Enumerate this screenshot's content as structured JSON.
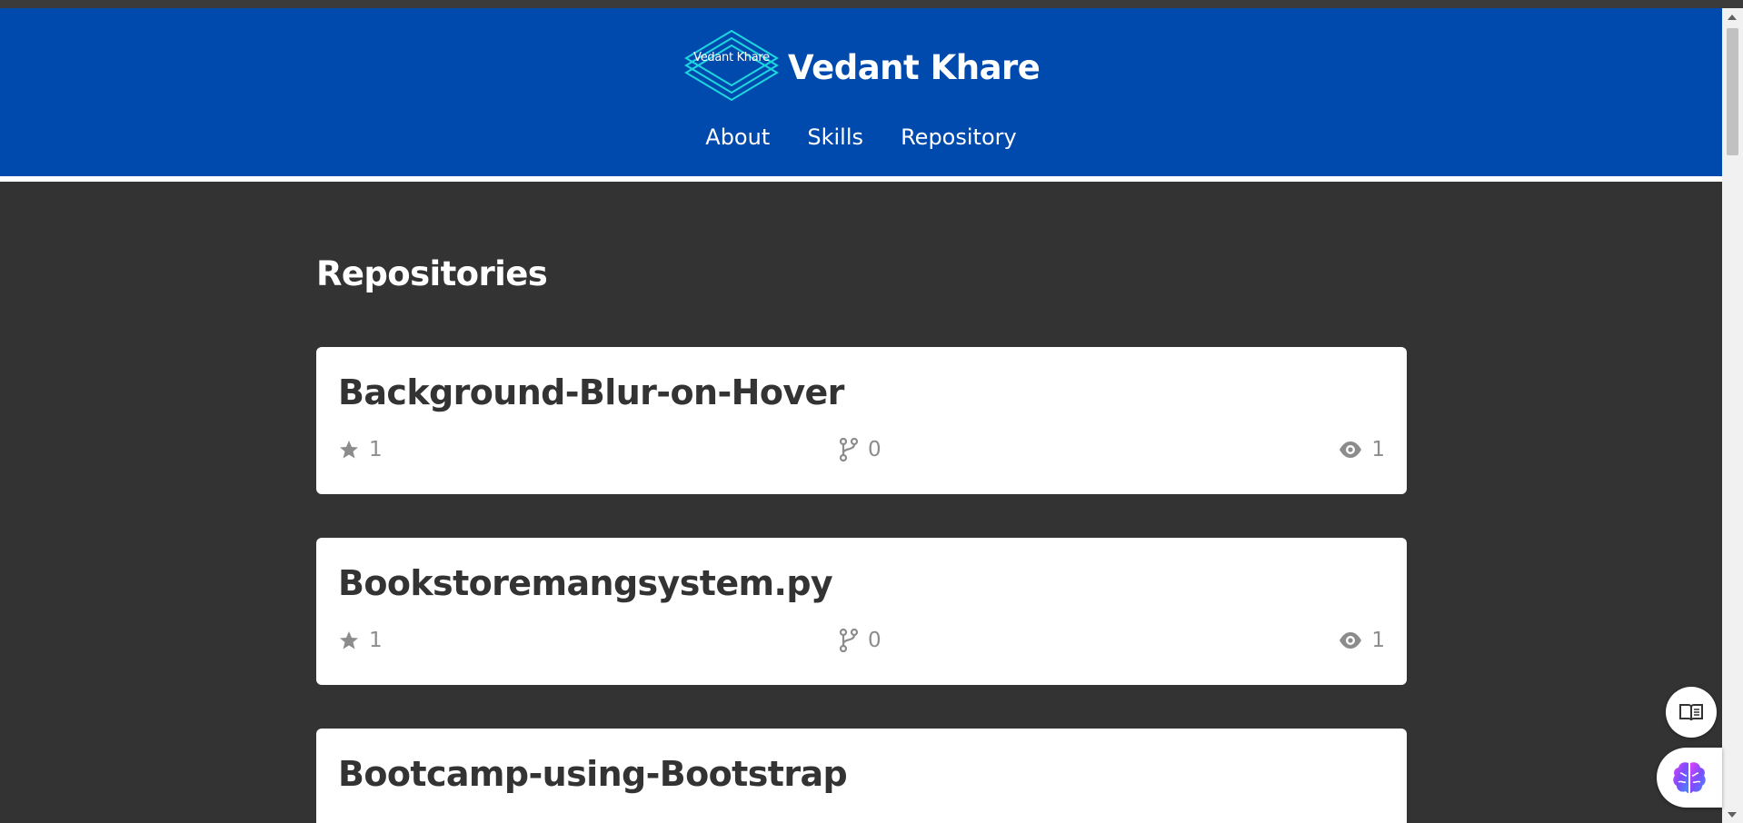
{
  "header": {
    "logo_text": "Vedant Khare",
    "site_title": "Vedant Khare",
    "nav": [
      "About",
      "Skills",
      "Repository"
    ]
  },
  "main": {
    "section_title": "Repositories",
    "repos": [
      {
        "name": "Background-Blur-on-Hover",
        "stars": "1",
        "forks": "0",
        "watchers": "1"
      },
      {
        "name": "Bookstoremangsystem.py",
        "stars": "1",
        "forks": "0",
        "watchers": "1"
      },
      {
        "name": "Bootcamp-using-Bootstrap"
      }
    ]
  },
  "colors": {
    "header_bg": "#004aad",
    "page_bg": "#333333",
    "card_bg": "#ffffff",
    "logo_accent": "#1ed6e0",
    "stat_gray": "#8c8c8c"
  },
  "icons": [
    "star-icon",
    "fork-icon",
    "eye-icon",
    "reader-mode-icon",
    "brain-icon"
  ]
}
